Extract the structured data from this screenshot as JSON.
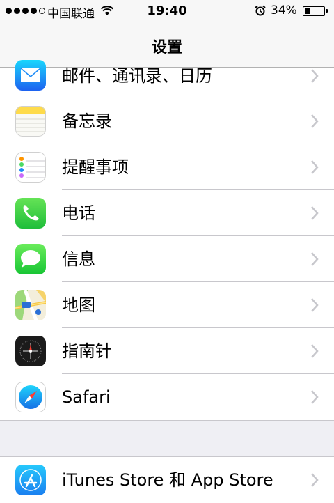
{
  "status_bar": {
    "carrier": "中国联通",
    "time": "19:40",
    "battery_percent": "34%",
    "battery_level": 0.34,
    "signal_bars_filled": 4,
    "signal_bars_total": 5
  },
  "nav": {
    "title": "设置"
  },
  "settings_items": [
    {
      "label": "邮件、通讯录、日历",
      "icon": "mail-icon"
    },
    {
      "label": "备忘录",
      "icon": "notes-icon"
    },
    {
      "label": "提醒事项",
      "icon": "reminders-icon"
    },
    {
      "label": "电话",
      "icon": "phone-icon"
    },
    {
      "label": "信息",
      "icon": "messages-icon"
    },
    {
      "label": "地图",
      "icon": "maps-icon"
    },
    {
      "label": "指南针",
      "icon": "compass-icon"
    },
    {
      "label": "Safari",
      "icon": "safari-icon"
    }
  ],
  "store_items": [
    {
      "label": "iTunes Store 和 App Store",
      "icon": "app-store-icon"
    }
  ],
  "colors": {
    "phone_green": "#4cd964",
    "messages_green": "#5ee05c",
    "mail_blue": "#1d8cf8",
    "notes_yellow": "#fedb4b",
    "app_store_blue": "#1ea3ee",
    "chevron_gray": "#c7c7cc"
  }
}
